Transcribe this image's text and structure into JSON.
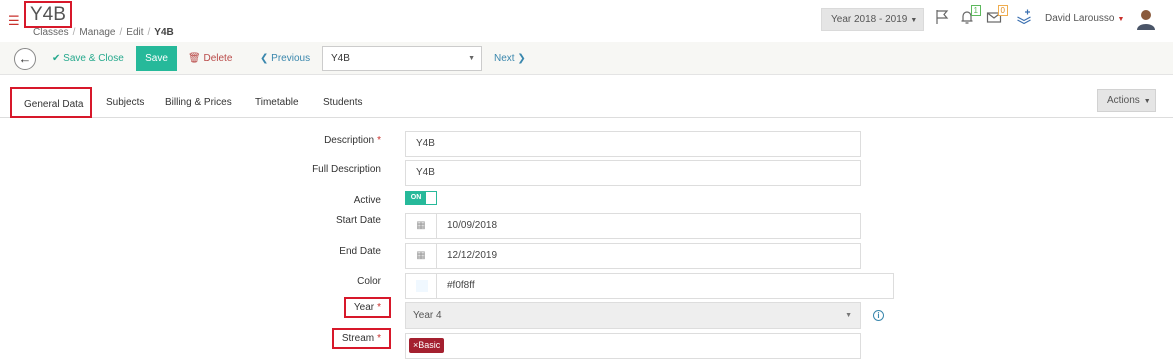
{
  "header": {
    "title": "Y4B",
    "breadcrumb": [
      "Classes",
      "Manage",
      "Edit",
      "Y4B"
    ],
    "school_year": "Year 2018 - 2019",
    "notification_count": "1",
    "message_count": "0",
    "user_name": "David Larousso"
  },
  "toolbar": {
    "save_close_label": "Save & Close",
    "save_label": "Save",
    "delete_label": "Delete",
    "previous_label": "Previous",
    "record_value": "Y4B",
    "next_label": "Next"
  },
  "tabs": [
    {
      "label": "General Data",
      "active": true
    },
    {
      "label": "Subjects"
    },
    {
      "label": "Billing & Prices"
    },
    {
      "label": "Timetable"
    },
    {
      "label": "Students"
    }
  ],
  "actions_label": "Actions",
  "form": {
    "description": {
      "label": "Description",
      "value": "Y4B"
    },
    "full_description": {
      "label": "Full Description",
      "value": "Y4B"
    },
    "active": {
      "label": "Active",
      "toggle_text": "ON",
      "value": true
    },
    "start_date": {
      "label": "Start Date",
      "value": "10/09/2018"
    },
    "end_date": {
      "label": "End Date",
      "value": "12/12/2019"
    },
    "color": {
      "label": "Color",
      "value": "#f0f8ff"
    },
    "year": {
      "label": "Year",
      "value": "Year 4"
    },
    "stream": {
      "label": "Stream",
      "tags": [
        "Basic"
      ]
    }
  },
  "colors": {
    "accent": "#26b99a",
    "danger": "#c9302c",
    "highlight": "#d7182a",
    "link": "#3a87ad",
    "tag": "#a4202f",
    "swatch": "#f0f8ff"
  }
}
